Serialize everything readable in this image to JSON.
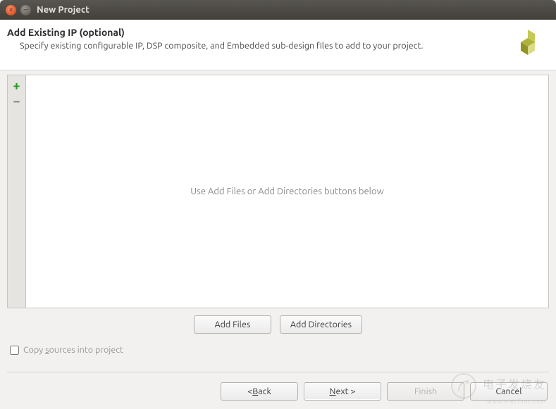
{
  "window": {
    "title": "New Project"
  },
  "header": {
    "title": "Add Existing IP (optional)",
    "description": "Specify existing configurable IP, DSP composite, and Embedded sub-design files to add to your project."
  },
  "file_area": {
    "placeholder": "Use Add Files or Add Directories buttons below"
  },
  "tools": {
    "add_label": "+",
    "remove_label": "−"
  },
  "file_buttons": {
    "add_files": "Add Files",
    "add_dirs": "Add Directories"
  },
  "options": {
    "copy_sources_label": "Copy sources into project",
    "copy_sources_checked": false
  },
  "footer": {
    "back": "< Back",
    "next": "Next >",
    "finish": "Finish",
    "cancel": "Cancel"
  },
  "watermark": {
    "line1": "电子发烧友",
    "line2": "www.elecfans.com"
  }
}
